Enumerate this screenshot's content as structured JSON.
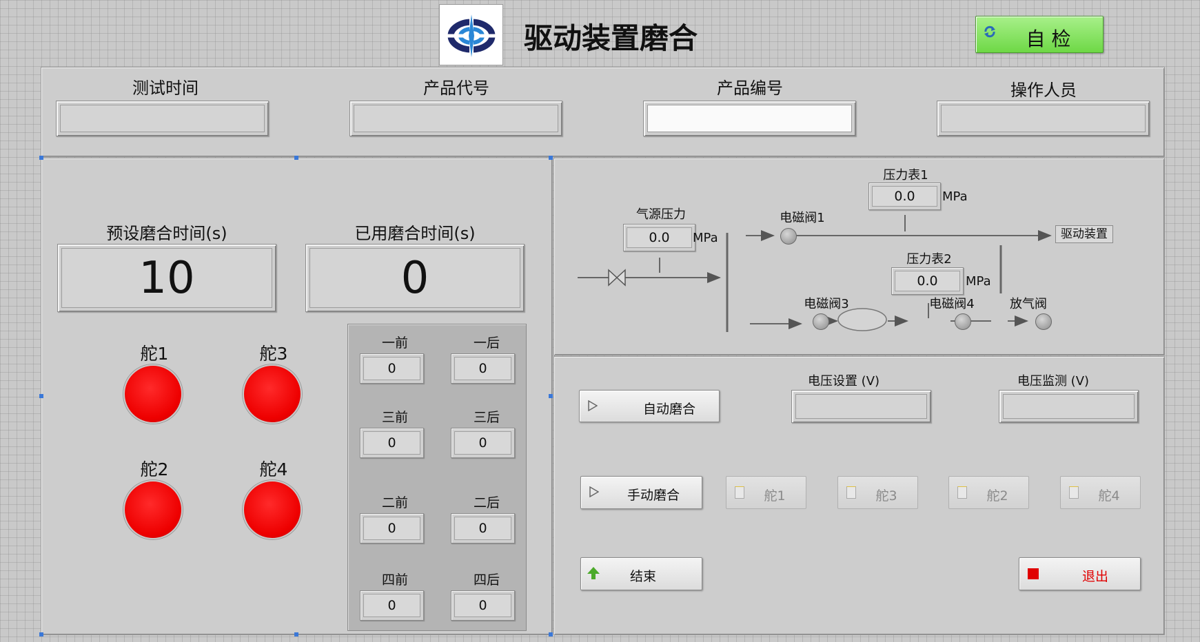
{
  "header": {
    "title": "驱动装置磨合",
    "self_check_label": "自 检",
    "colors": {
      "self_check_bg": "#7ee05a",
      "led_red": "#ee0000",
      "stop_red": "#e00000"
    }
  },
  "info": {
    "test_time_label": "测试时间",
    "product_code_label": "产品代号",
    "product_serial_label": "产品编号",
    "operator_label": "操作人员"
  },
  "times": {
    "preset_label": "预设磨合时间(s)",
    "preset_value": "10",
    "elapsed_label": "已用磨合时间(s)",
    "elapsed_value": "0"
  },
  "rudders": [
    {
      "label": "舵1"
    },
    {
      "label": "舵3"
    },
    {
      "label": "舵2"
    },
    {
      "label": "舵4"
    }
  ],
  "counters": [
    {
      "label": "一前",
      "value": "0"
    },
    {
      "label": "一后",
      "value": "0"
    },
    {
      "label": "三前",
      "value": "0"
    },
    {
      "label": "三后",
      "value": "0"
    },
    {
      "label": "二前",
      "value": "0"
    },
    {
      "label": "二后",
      "value": "0"
    },
    {
      "label": "四前",
      "value": "0"
    },
    {
      "label": "四后",
      "value": "0"
    }
  ],
  "pneumatic": {
    "source_label": "气源压力",
    "source_value": "0.0",
    "source_unit": "MPa",
    "gauge1_label": "压力表1",
    "gauge1_value": "0.0",
    "gauge1_unit": "MPa",
    "gauge2_label": "压力表2",
    "gauge2_value": "0.0",
    "gauge2_unit": "MPa",
    "valve1_label": "电磁阀1",
    "valve3_label": "电磁阀3",
    "valve4_label": "电磁阀4",
    "vent_label": "放气阀",
    "drive_label": "驱动装置"
  },
  "control": {
    "voltage_set_label": "电压设置 (V)",
    "voltage_monitor_label": "电压监测 (V)",
    "auto_label": "自动磨合",
    "manual_label": "手动磨合",
    "manual_rudders": [
      "舵1",
      "舵3",
      "舵2",
      "舵4"
    ],
    "end_label": "结束",
    "exit_label": "退出"
  }
}
